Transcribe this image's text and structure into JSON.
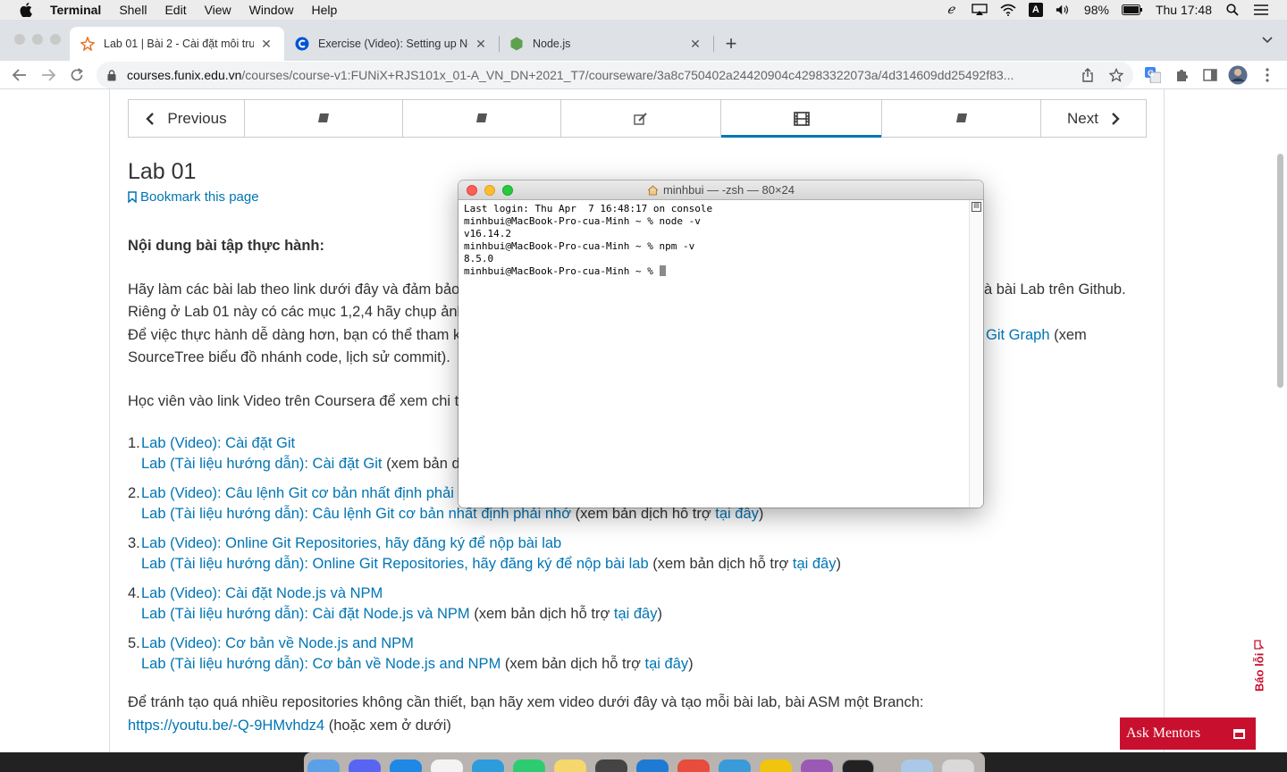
{
  "menubar": {
    "app": "Terminal",
    "items": [
      "Shell",
      "Edit",
      "View",
      "Window",
      "Help"
    ],
    "battery": "98%",
    "clock": "Thu 17:48"
  },
  "tabs": [
    {
      "title": "Lab 01 | Bài 2 - Cài đặt môi trư",
      "active": true
    },
    {
      "title": "Exercise (Video): Setting up No",
      "active": false
    },
    {
      "title": "Node.js",
      "active": false
    }
  ],
  "toolbar": {
    "url_host": "courses.funix.edu.vn",
    "url_path": "/courses/course-v1:FUNiX+RJS101x_01-A_VN_DN+2021_T7/courseware/3a8c750402a24420904c42983322073a/4d314609dd25492f83..."
  },
  "seqnav": {
    "previous": "Previous",
    "next": "Next"
  },
  "lab": {
    "title": "Lab 01",
    "bookmark": "Bookmark this page",
    "heading": "Nội dung bài tập thực hành:",
    "p1_left": "Hãy làm các bài lab theo link dưới đây và đảm bảo",
    "p1_right": "à bài Lab trên Github.",
    "p2_left": "Riêng ở Lab 01 này có các mục 1,2,4 hãy chụp ảnh",
    "p3_left": "Để việc thực hành dễ dàng hơn, bạn có thể tham k",
    "p3_link": "Git Graph",
    "p3_right": " (xem",
    "p4": "SourceTree biểu đồ nhánh code, lịch sử commit).",
    "p5_left": "Học viên vào link Video trên Coursera để xem chi t"
  },
  "labs": [
    {
      "num": "1.",
      "video": "Lab (Video): Cài đặt Git",
      "doc": "Lab (Tài liệu hướng dẫn): Cài đặt Git",
      "doc_suffix": " (xem bản dị",
      "here": ""
    },
    {
      "num": "2.",
      "video": "Lab (Video): Câu lệnh Git cơ bản nhất định phải n",
      "doc": "Lab (Tài liệu hướng dẫn): Câu lệnh Git cơ bản nhất định phải nhớ",
      "doc_suffix": " (xem bản dịch hỗ trợ ",
      "here": "tại đây",
      "close": ")"
    },
    {
      "num": "3.",
      "video": "Lab (Video): Online Git Repositories, hãy đăng ký để nộp bài lab",
      "doc": "Lab (Tài liệu hướng dẫn): Online Git Repositories, hãy đăng ký để nộp bài lab",
      "doc_suffix": " (xem bản dịch hỗ trợ ",
      "here": "tại đây",
      "close": ")"
    },
    {
      "num": "4.",
      "video": "Lab (Video): Cài đặt Node.js và NPM",
      "doc": "Lab (Tài liệu hướng dẫn): Cài đặt Node.js và NPM",
      "doc_suffix": " (xem bản dịch hỗ trợ ",
      "here": "tại đây",
      "close": ")"
    },
    {
      "num": "5.",
      "video": "Lab (Video): Cơ bản về Node.js and NPM",
      "doc": "Lab (Tài liệu hướng dẫn): Cơ bản về Node.js and NPM",
      "doc_suffix": " (xem bản dịch hỗ trợ ",
      "here": "tại đây",
      "close": ")"
    }
  ],
  "footer_text": {
    "line1": "Để tránh tạo quá nhiều repositories không cần thiết, bạn hãy xem video dưới đây và tạo mỗi bài lab, bài ASM một Branch:",
    "link": "https://youtu.be/-Q-9HMvhdz4",
    "after_link": " (hoặc xem ở dưới)"
  },
  "widgets": {
    "bao_loi": "Báo lỗi",
    "ask_mentors": "Ask Mentors"
  },
  "terminal": {
    "title": "minhbui — -zsh — 80×24",
    "lines": [
      "Last login: Thu Apr  7 16:48:17 on console",
      "minhbui@MacBook-Pro-cua-Minh ~ % node -v",
      "v16.14.2",
      "minhbui@MacBook-Pro-cua-Minh ~ % npm -v",
      "8.5.0",
      "minhbui@MacBook-Pro-cua-Minh ~ % "
    ]
  },
  "colors": {
    "link": "#0075b4",
    "accent_red": "#c8102e",
    "tl_red": "#fe5f57",
    "tl_yellow": "#febc2e",
    "tl_green": "#28c840"
  }
}
